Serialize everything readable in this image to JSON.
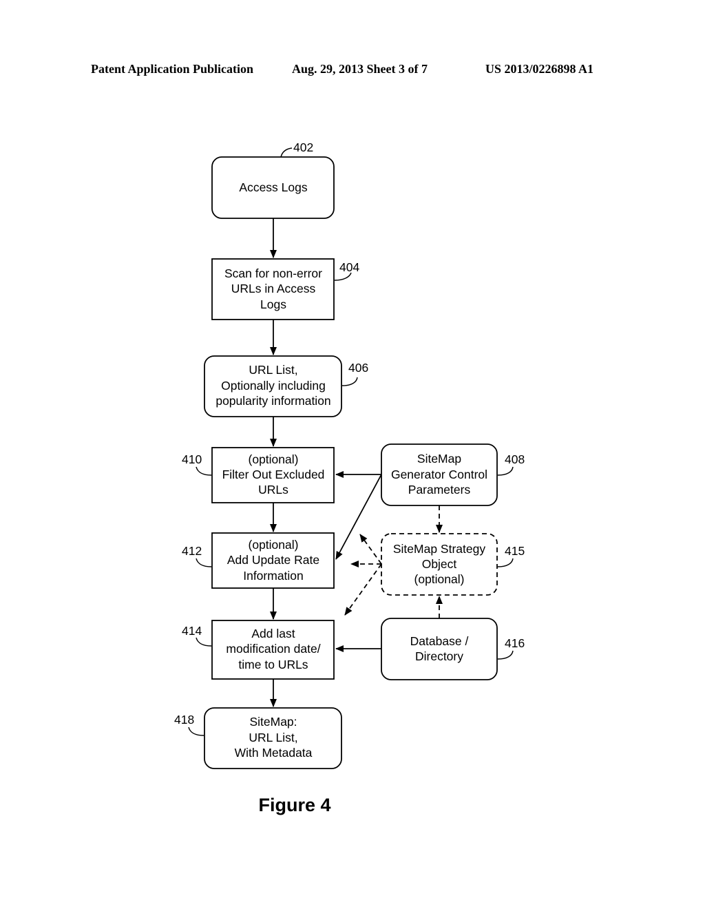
{
  "header": {
    "left": "Patent Application Publication",
    "middle": "Aug. 29, 2013  Sheet 3 of 7",
    "right": "US 2013/0226898 A1"
  },
  "figure_title": "Figure 4",
  "nodes": {
    "n402": {
      "ref": "402",
      "shape": "rounded",
      "lines": [
        "Access Logs"
      ]
    },
    "n404": {
      "ref": "404",
      "shape": "rect",
      "lines": [
        "Scan for non-error",
        "URLs in Access",
        "Logs"
      ]
    },
    "n406": {
      "ref": "406",
      "shape": "rounded",
      "lines": [
        "URL List,",
        "Optionally including",
        "popularity information"
      ]
    },
    "n410": {
      "ref": "410",
      "shape": "rect",
      "lines": [
        "(optional)",
        "Filter Out Excluded",
        "URLs"
      ]
    },
    "n408": {
      "ref": "408",
      "shape": "rounded",
      "lines": [
        "SiteMap",
        "Generator Control",
        "Parameters"
      ]
    },
    "n412": {
      "ref": "412",
      "shape": "rect",
      "lines": [
        "(optional)",
        "Add Update Rate",
        "Information"
      ]
    },
    "n415": {
      "ref": "415",
      "shape": "rounded-dashed",
      "lines": [
        "SiteMap Strategy",
        "Object",
        "(optional)"
      ]
    },
    "n414": {
      "ref": "414",
      "shape": "rect",
      "lines": [
        "Add last",
        "modification date/",
        "time to URLs"
      ]
    },
    "n416": {
      "ref": "416",
      "shape": "rounded",
      "lines": [
        "Database /",
        "Directory"
      ]
    },
    "n418": {
      "ref": "418",
      "shape": "rounded",
      "lines": [
        "SiteMap:",
        "URL List,",
        "With Metadata"
      ]
    }
  },
  "edges": [
    {
      "from": "402",
      "to": "404",
      "style": "solid"
    },
    {
      "from": "404",
      "to": "406",
      "style": "solid"
    },
    {
      "from": "406",
      "to": "410",
      "style": "solid"
    },
    {
      "from": "410",
      "to": "412",
      "style": "solid"
    },
    {
      "from": "412",
      "to": "414",
      "style": "solid"
    },
    {
      "from": "414",
      "to": "418",
      "style": "solid"
    },
    {
      "from": "408",
      "to": "410",
      "style": "solid"
    },
    {
      "from": "408",
      "to": "412",
      "style": "solid"
    },
    {
      "from": "408",
      "to": "415",
      "style": "dashed"
    },
    {
      "from": "416",
      "to": "415",
      "style": "dashed"
    },
    {
      "from": "416",
      "to": "414",
      "style": "solid"
    },
    {
      "from": "415",
      "to": "410-412 gap",
      "style": "dashed"
    },
    {
      "from": "415",
      "to": "412",
      "style": "dashed"
    },
    {
      "from": "415",
      "to": "412-414 gap",
      "style": "dashed"
    }
  ]
}
